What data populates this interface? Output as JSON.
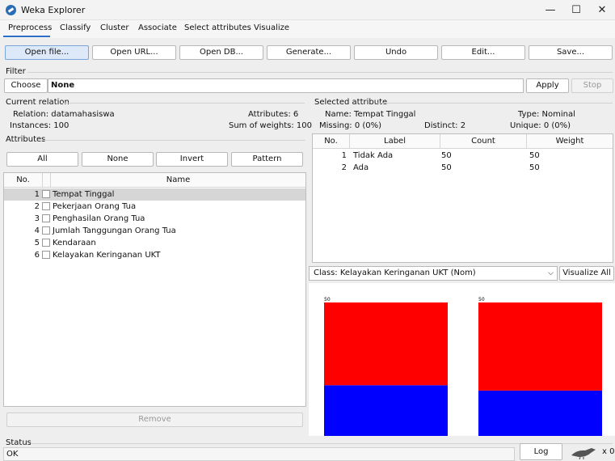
{
  "window": {
    "title": "Weka Explorer",
    "minimize": "—",
    "maximize": "☐",
    "close": "✕"
  },
  "tabs": [
    "Preprocess",
    "Classify",
    "Cluster",
    "Associate",
    "Select attributes",
    "Visualize"
  ],
  "toolbar": [
    "Open file...",
    "Open URL...",
    "Open DB...",
    "Generate...",
    "Undo",
    "Edit...",
    "Save..."
  ],
  "filter": {
    "title": "Filter",
    "choose_label": "Choose",
    "value": "None",
    "apply_label": "Apply",
    "stop_label": "Stop"
  },
  "current_relation": {
    "title": "Current relation",
    "relation": "Relation: datamahasiswa",
    "instances": "Instances: 100",
    "attributes": "Attributes: 6",
    "sum_weights": "Sum of weights: 100"
  },
  "attributes": {
    "title": "Attributes",
    "buttons": [
      "All",
      "None",
      "Invert",
      "Pattern"
    ],
    "col_no": "No.",
    "col_name": "Name",
    "rows": [
      {
        "no": "1",
        "name": "Tempat Tinggal"
      },
      {
        "no": "2",
        "name": "Pekerjaan Orang Tua"
      },
      {
        "no": "3",
        "name": "Penghasilan Orang Tua"
      },
      {
        "no": "4",
        "name": "Jumlah Tanggungan Orang Tua"
      },
      {
        "no": "5",
        "name": "Kendaraan"
      },
      {
        "no": "6",
        "name": "Kelayakan Keringanan UKT"
      }
    ],
    "remove_label": "Remove"
  },
  "selected_attribute": {
    "title": "Selected attribute",
    "name": "Name: Tempat Tinggal",
    "type": "Type: Nominal",
    "missing": "Missing: 0 (0%)",
    "distinct": "Distinct: 2",
    "unique": "Unique: 0 (0%)",
    "cols": [
      "No.",
      "Label",
      "Count",
      "Weight"
    ],
    "rows": [
      {
        "no": "1",
        "label": "Tidak Ada",
        "count": "50",
        "weight": "50"
      },
      {
        "no": "2",
        "label": "Ada",
        "count": "50",
        "weight": "50"
      }
    ]
  },
  "class_select": {
    "value": "Class: Kelayakan Keringanan UKT (Nom)",
    "visualize_all": "Visualize All"
  },
  "chart_data": {
    "type": "bar",
    "stacked": true,
    "categories": [
      "Tidak Ada",
      "Ada"
    ],
    "series": [
      {
        "color": "#ff0000",
        "values": [
          31,
          33
        ]
      },
      {
        "color": "#0000ff",
        "values": [
          19,
          17
        ]
      }
    ],
    "data_labels": [
      "50",
      "50"
    ],
    "ylim": [
      0,
      50
    ]
  },
  "status": {
    "title": "Status",
    "text": "OK",
    "log_label": "Log",
    "count": "x 0"
  }
}
